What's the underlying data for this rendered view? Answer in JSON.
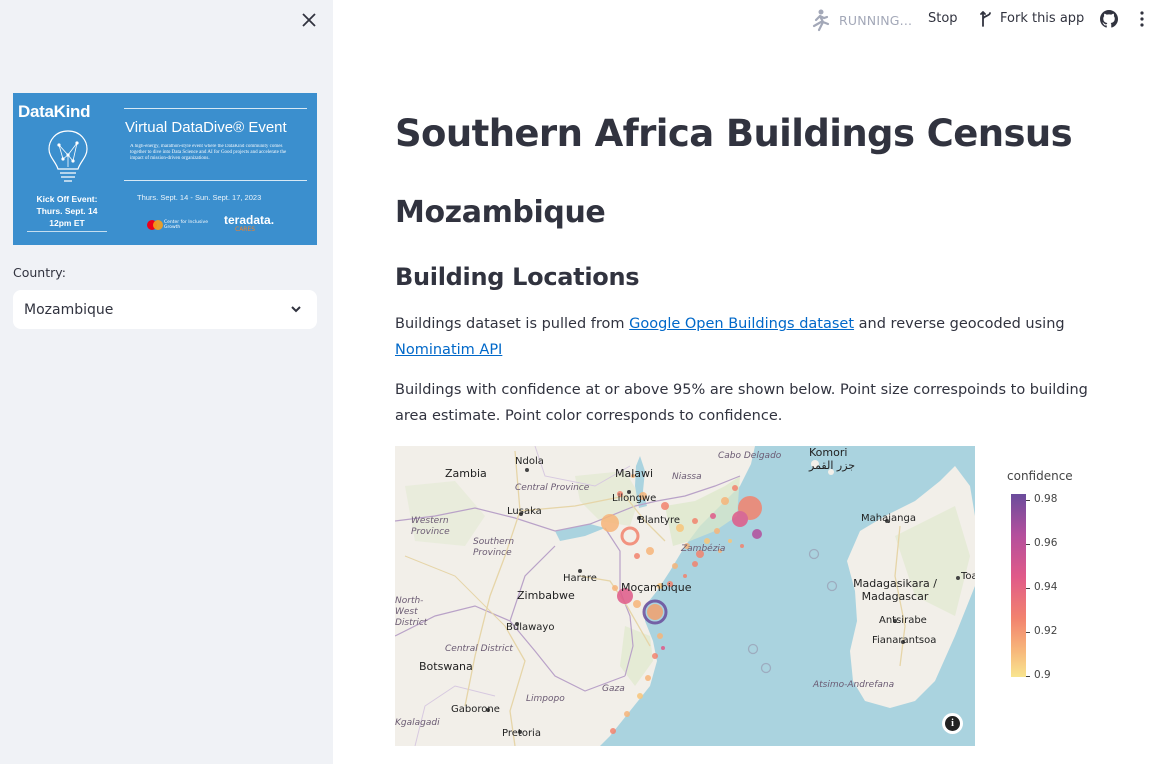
{
  "sidebar": {
    "close_icon": "close-icon",
    "banner": {
      "logo": "DataKind",
      "title": "Virtual DataDive® Event",
      "description": "A high-energy, marathon-style event where the DataKind community comes together to dive into Data Science and AI for Good projects and accelerate the impact of mission-driven organizations.",
      "kickoff": [
        "Kick Off Event:",
        "Thurs. Sept. 14",
        "12pm ET"
      ],
      "dates": "Thurs. Sept. 14 - Sun. Sept. 17, 2023",
      "sponsor1": "Center for Inclusive Growth",
      "sponsor2": "teradata.",
      "sponsor2_sub": "CARES"
    },
    "country_label": "Country:",
    "country_value": "Mozambique"
  },
  "toolbar": {
    "running_text": "RUNNING...",
    "stop_label": "Stop",
    "fork_label": "Fork this app"
  },
  "main": {
    "title": "Southern Africa Buildings Census",
    "country_heading": "Mozambique",
    "section_heading": "Building Locations",
    "p1_before": "Buildings dataset is pulled from ",
    "p1_link1": "Google Open Buildings dataset",
    "p1_middle": " and reverse geocoded using ",
    "p1_link2": "Nominatim API",
    "p2": "Buildings with confidence at or above 95% are shown below. Point size correspoinds to building area estimate. Point color corresponds to confidence."
  },
  "map": {
    "labels": {
      "zambia": "Zambia",
      "ndola": "Ndola",
      "malawi": "Malawi",
      "niassa": "Niassa",
      "cabo_delgado": "Cabo Delgado",
      "komori": "Komori جزر القمر",
      "central_province": "Central Province",
      "lilongwe": "Lilongwe",
      "lusaka": "Lusaka",
      "blantyre": "Blantyre",
      "western_province": "Western Province",
      "southern_province": "Southern Province",
      "mahajanga": "Mahajanga",
      "zambezia": "Zambézia",
      "harare": "Harare",
      "mocambique": "Moçambique",
      "madagasikara": "Madagasikara / Madagascar",
      "toamasina": "Toam",
      "zimbabwe": "Zimbabwe",
      "north_west": "North-West District",
      "bulawayo": "Bulawayo",
      "antsirabe": "Antsirabe",
      "fianarantsoa": "Fianarantsoa",
      "central_district": "Central District",
      "botswana": "Botswana",
      "atsimo": "Atsimo-Andrefana",
      "limpopo": "Limpopo",
      "gaza": "Gaza",
      "gaborone": "Gaborone",
      "kgalagadi": "Kgalagadi",
      "pretoria": "Pretoria"
    },
    "colorbar": {
      "title": "confidence",
      "ticks": [
        "0.98",
        "0.96",
        "0.94",
        "0.92",
        "0.9"
      ]
    }
  }
}
